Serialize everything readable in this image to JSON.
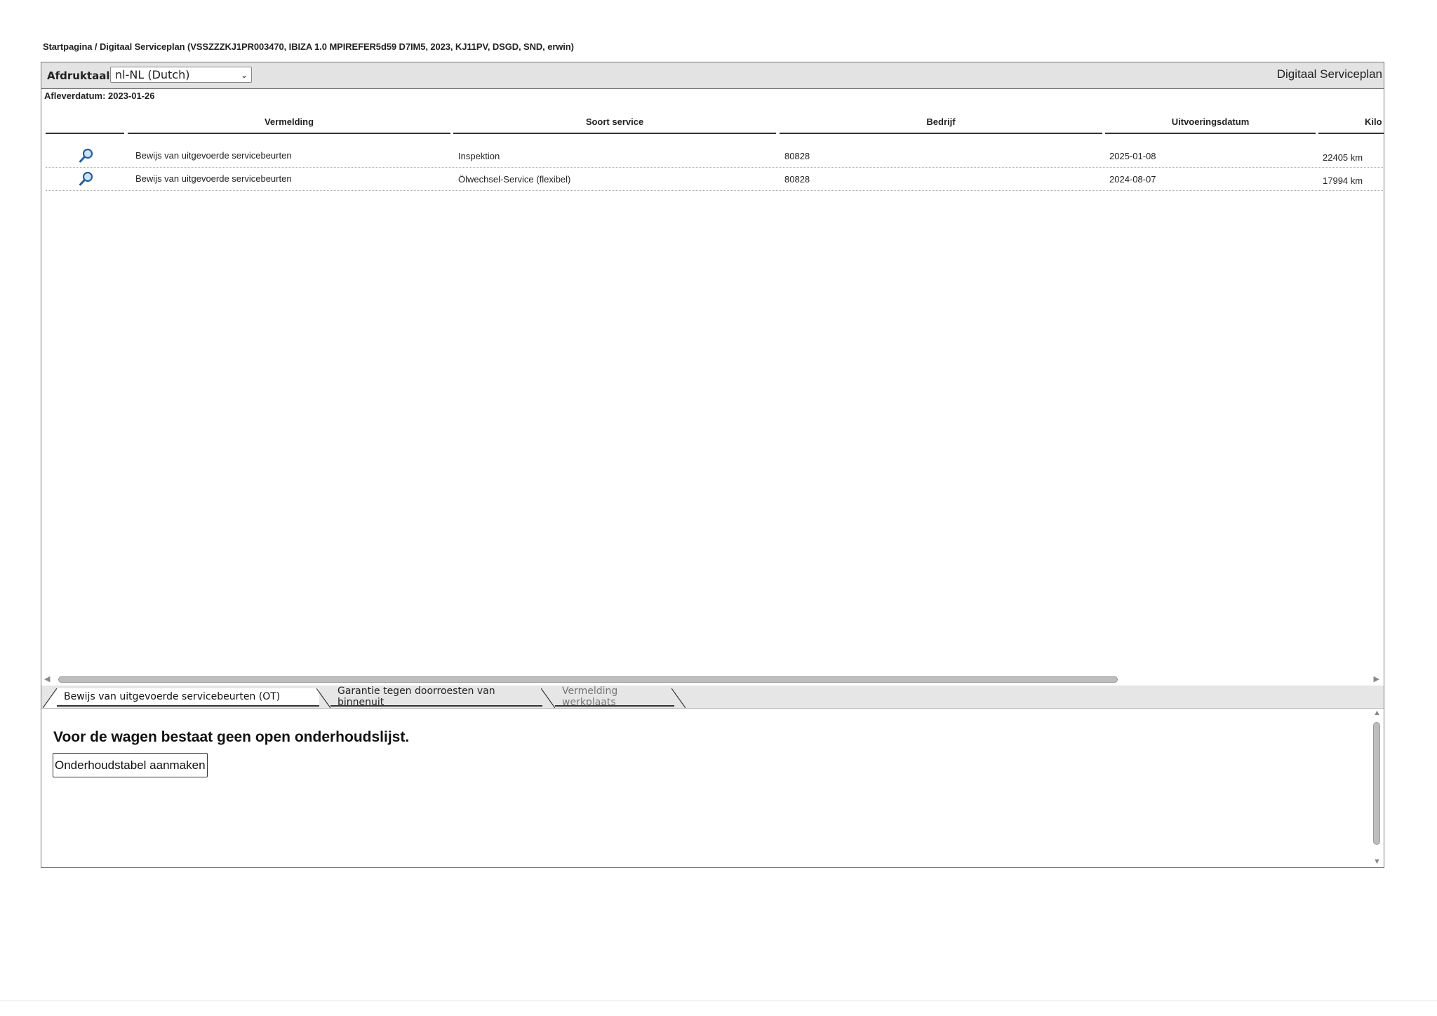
{
  "breadcrumb": "Startpagina / Digitaal Serviceplan (VSSZZZKJ1PR003470, IBIZA 1.0 MPIREFER5d59 D7IM5, 2023, KJ11PV, DSGD, SND, erwin)",
  "header": {
    "language_label": "Afdruktaal:",
    "language_value": "nl-NL (Dutch)",
    "app_title": "Digitaal Serviceplan"
  },
  "delivery_date": "Afleverdatum: 2023-01-26",
  "table": {
    "columns": [
      "Vermelding",
      "Soort service",
      "Bedrijf",
      "Uitvoeringsdatum",
      "Kilo"
    ],
    "rows": [
      {
        "icon": "magnifier-icon",
        "vermelding": "Bewijs van uitgevoerde servicebeurten",
        "soort": "Inspektion",
        "bedrijf": "80828",
        "datum": "2025-01-08",
        "km": "22405 km"
      },
      {
        "icon": "magnifier-icon",
        "vermelding": "Bewijs van uitgevoerde servicebeurten",
        "soort": "Ölwechsel-Service (flexibel)",
        "bedrijf": "80828",
        "datum": "2024-08-07",
        "km": "17994 km"
      }
    ]
  },
  "tabs": [
    {
      "label": "Bewijs van uitgevoerde servicebeurten (OT)",
      "state": "active"
    },
    {
      "label": "Garantie tegen doorroesten van binnenuit",
      "state": "normal"
    },
    {
      "label": "Vermelding werkplaats",
      "state": "muted"
    }
  ],
  "lower": {
    "message": "Voor de wagen bestaat geen open onderhoudslijst.",
    "button_label": "Onderhoudstabel aanmaken"
  },
  "colors": {
    "header_bg": "#e3e3e3",
    "border": "#777777",
    "text": "#222222",
    "icon_blue": "#1f5fa8"
  }
}
